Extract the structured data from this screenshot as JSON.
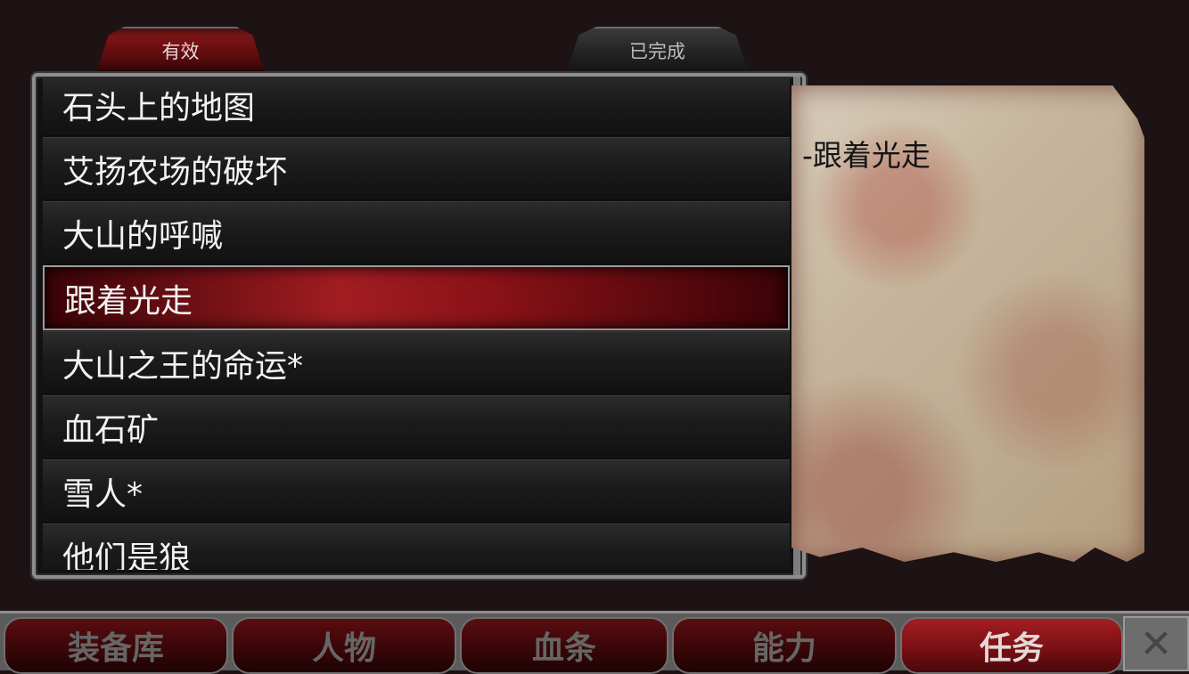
{
  "tabs": {
    "active": "有效",
    "completed": "已完成"
  },
  "quests": [
    {
      "label": "石头上的地图"
    },
    {
      "label": "艾扬农场的破坏"
    },
    {
      "label": "大山的呼喊"
    },
    {
      "label": "跟着光走",
      "selected": true
    },
    {
      "label": "大山之王的命运*"
    },
    {
      "label": "血石矿"
    },
    {
      "label": "雪人*"
    },
    {
      "label": "他们是狼"
    }
  ],
  "detail": {
    "text": "-跟着光走"
  },
  "nav": {
    "items": [
      {
        "label": "装备库"
      },
      {
        "label": "人物"
      },
      {
        "label": "血条"
      },
      {
        "label": "能力"
      },
      {
        "label": "任务",
        "active": true
      }
    ],
    "close_icon": "close-icon"
  }
}
